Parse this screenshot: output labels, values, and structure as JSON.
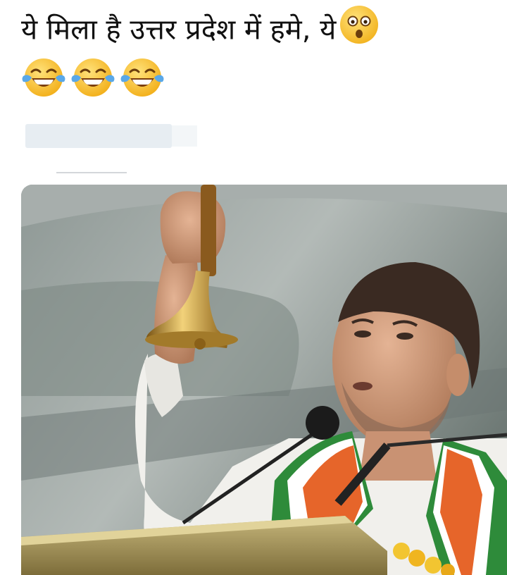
{
  "post": {
    "caption_text": "ये मिला है उत्तर प्रदेश में हमे, ये",
    "caption_emoji": "astonished-face-emoji",
    "reaction_emojis": [
      "face-with-tears-of-joy",
      "face-with-tears-of-joy",
      "face-with-tears-of-joy"
    ]
  },
  "photo": {
    "subject": "man in white kurta with tricolor scarf ringing a brass bell at a podium with microphones"
  },
  "colors": {
    "background": "#ffffff",
    "emoji_yellow": "#f7c531",
    "redaction_bar": "#e7edf2",
    "scarf_orange": "#e6652a",
    "scarf_green": "#2e8b3a",
    "bell_gold": "#c99a35"
  }
}
